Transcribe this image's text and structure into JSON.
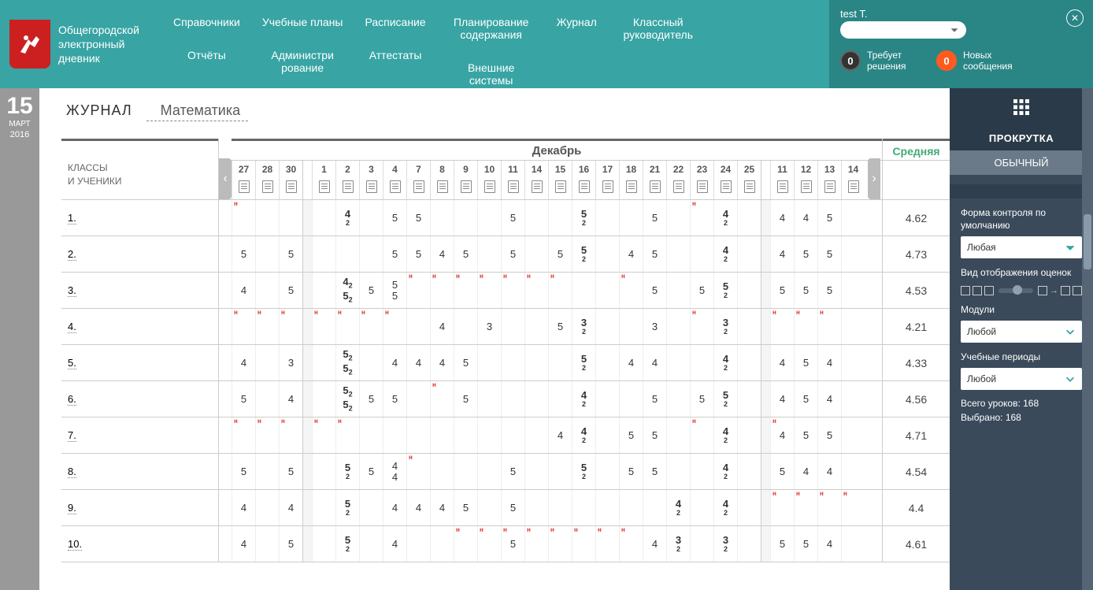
{
  "app_title": "Общегородской электронный дневник",
  "nav": {
    "col1": [
      "Справочники",
      "Отчёты"
    ],
    "col2": [
      "Учебные планы",
      "Администри рование"
    ],
    "col3": [
      "Расписание",
      "Аттестаты"
    ],
    "col4": [
      "Планирование содержания",
      "Внешние системы"
    ],
    "col5": [
      "Журнал"
    ],
    "col6": [
      "Классный руководитель"
    ]
  },
  "user": {
    "name": "test T.",
    "counter1_value": "0",
    "counter1_label": "Требует решения",
    "counter2_value": "0",
    "counter2_label": "Новых сообщения"
  },
  "date": {
    "day": "15",
    "month": "МАРТ",
    "year": "2016"
  },
  "page": {
    "title": "ЖУРНАЛ",
    "subject": "Математика"
  },
  "grid": {
    "left_header": "КЛАССЫ\nИ УЧЕНИКИ",
    "month_label": "Декабрь",
    "avg_label": "Средняя",
    "days": [
      "27",
      "28",
      "30",
      "1",
      "2",
      "3",
      "4",
      "7",
      "8",
      "9",
      "10",
      "11",
      "14",
      "15",
      "16",
      "17",
      "18",
      "21",
      "22",
      "23",
      "24",
      "25",
      "11",
      "12",
      "13",
      "14"
    ],
    "sep_after_indices": [
      2,
      21
    ],
    "students": [
      "1.",
      "2.",
      "3.",
      "4.",
      "5.",
      "6.",
      "7.",
      "8.",
      "9.",
      "10."
    ],
    "averages": [
      "4.62",
      "4.73",
      "4.53",
      "4.21",
      "4.33",
      "4.56",
      "4.71",
      "4.54",
      "4.4",
      "4.61"
    ],
    "grades": [
      {
        "r": 0,
        "c": 4,
        "v": "4",
        "s": "2",
        "b": true
      },
      {
        "r": 0,
        "c": 6,
        "v": "5"
      },
      {
        "r": 0,
        "c": 7,
        "v": "5"
      },
      {
        "r": 0,
        "c": 11,
        "v": "5"
      },
      {
        "r": 0,
        "c": 14,
        "v": "5",
        "s": "2",
        "b": true
      },
      {
        "r": 0,
        "c": 17,
        "v": "5"
      },
      {
        "r": 0,
        "c": 20,
        "v": "4",
        "s": "2",
        "b": true
      },
      {
        "r": 0,
        "c": 22,
        "v": "4"
      },
      {
        "r": 0,
        "c": 23,
        "v": "4"
      },
      {
        "r": 0,
        "c": 24,
        "v": "5"
      },
      {
        "r": 1,
        "c": 0,
        "v": "5"
      },
      {
        "r": 1,
        "c": 2,
        "v": "5"
      },
      {
        "r": 1,
        "c": 6,
        "v": "5"
      },
      {
        "r": 1,
        "c": 7,
        "v": "5"
      },
      {
        "r": 1,
        "c": 8,
        "v": "4"
      },
      {
        "r": 1,
        "c": 9,
        "v": "5"
      },
      {
        "r": 1,
        "c": 11,
        "v": "5"
      },
      {
        "r": 1,
        "c": 13,
        "v": "5"
      },
      {
        "r": 1,
        "c": 14,
        "v": "5",
        "s": "2",
        "b": true
      },
      {
        "r": 1,
        "c": 16,
        "v": "4"
      },
      {
        "r": 1,
        "c": 17,
        "v": "5"
      },
      {
        "r": 1,
        "c": 20,
        "v": "4",
        "s": "2",
        "b": true
      },
      {
        "r": 1,
        "c": 22,
        "v": "4"
      },
      {
        "r": 1,
        "c": 23,
        "v": "5"
      },
      {
        "r": 1,
        "c": 24,
        "v": "5"
      },
      {
        "r": 2,
        "c": 0,
        "v": "4"
      },
      {
        "r": 2,
        "c": 2,
        "v": "5"
      },
      {
        "r": 2,
        "c": 4,
        "v2": [
          "4₂",
          "5₂"
        ],
        "b": true
      },
      {
        "r": 2,
        "c": 5,
        "v": "5"
      },
      {
        "r": 2,
        "c": 6,
        "v2": [
          "5",
          "5"
        ]
      },
      {
        "r": 2,
        "c": 17,
        "v": "5"
      },
      {
        "r": 2,
        "c": 19,
        "v": "5"
      },
      {
        "r": 2,
        "c": 20,
        "v": "5",
        "s": "2",
        "b": true
      },
      {
        "r": 2,
        "c": 22,
        "v": "5"
      },
      {
        "r": 2,
        "c": 23,
        "v": "5"
      },
      {
        "r": 2,
        "c": 24,
        "v": "5"
      },
      {
        "r": 3,
        "c": 8,
        "v": "4"
      },
      {
        "r": 3,
        "c": 10,
        "v": "3"
      },
      {
        "r": 3,
        "c": 13,
        "v": "5"
      },
      {
        "r": 3,
        "c": 14,
        "v": "3",
        "s": "2",
        "b": true
      },
      {
        "r": 3,
        "c": 17,
        "v": "3"
      },
      {
        "r": 3,
        "c": 20,
        "v": "3",
        "s": "2",
        "b": true
      },
      {
        "r": 4,
        "c": 0,
        "v": "4"
      },
      {
        "r": 4,
        "c": 2,
        "v": "3"
      },
      {
        "r": 4,
        "c": 4,
        "v2": [
          "5₂",
          "5₂"
        ],
        "b": true
      },
      {
        "r": 4,
        "c": 6,
        "v": "4"
      },
      {
        "r": 4,
        "c": 7,
        "v": "4"
      },
      {
        "r": 4,
        "c": 8,
        "v": "4"
      },
      {
        "r": 4,
        "c": 9,
        "v": "5"
      },
      {
        "r": 4,
        "c": 14,
        "v": "5",
        "s": "2",
        "b": true
      },
      {
        "r": 4,
        "c": 16,
        "v": "4"
      },
      {
        "r": 4,
        "c": 17,
        "v": "4"
      },
      {
        "r": 4,
        "c": 20,
        "v": "4",
        "s": "2",
        "b": true
      },
      {
        "r": 4,
        "c": 22,
        "v": "4"
      },
      {
        "r": 4,
        "c": 23,
        "v": "5"
      },
      {
        "r": 4,
        "c": 24,
        "v": "4"
      },
      {
        "r": 5,
        "c": 0,
        "v": "5"
      },
      {
        "r": 5,
        "c": 2,
        "v": "4"
      },
      {
        "r": 5,
        "c": 4,
        "v2": [
          "5₂",
          "5₂"
        ],
        "b": true
      },
      {
        "r": 5,
        "c": 5,
        "v": "5"
      },
      {
        "r": 5,
        "c": 6,
        "v": "5"
      },
      {
        "r": 5,
        "c": 9,
        "v": "5"
      },
      {
        "r": 5,
        "c": 14,
        "v": "4",
        "s": "2",
        "b": true
      },
      {
        "r": 5,
        "c": 17,
        "v": "5"
      },
      {
        "r": 5,
        "c": 19,
        "v": "5"
      },
      {
        "r": 5,
        "c": 20,
        "v": "5",
        "s": "2",
        "b": true
      },
      {
        "r": 5,
        "c": 22,
        "v": "4"
      },
      {
        "r": 5,
        "c": 23,
        "v": "5"
      },
      {
        "r": 5,
        "c": 24,
        "v": "4"
      },
      {
        "r": 6,
        "c": 13,
        "v": "4"
      },
      {
        "r": 6,
        "c": 14,
        "v": "4",
        "s": "2",
        "b": true
      },
      {
        "r": 6,
        "c": 16,
        "v": "5"
      },
      {
        "r": 6,
        "c": 17,
        "v": "5"
      },
      {
        "r": 6,
        "c": 20,
        "v": "4",
        "s": "2",
        "b": true
      },
      {
        "r": 6,
        "c": 22,
        "v": "4"
      },
      {
        "r": 6,
        "c": 23,
        "v": "5"
      },
      {
        "r": 6,
        "c": 24,
        "v": "5"
      },
      {
        "r": 7,
        "c": 0,
        "v": "5"
      },
      {
        "r": 7,
        "c": 2,
        "v": "5"
      },
      {
        "r": 7,
        "c": 4,
        "v": "5",
        "s": "2",
        "b": true
      },
      {
        "r": 7,
        "c": 5,
        "v": "5"
      },
      {
        "r": 7,
        "c": 6,
        "v2": [
          "4",
          "4"
        ]
      },
      {
        "r": 7,
        "c": 11,
        "v": "5"
      },
      {
        "r": 7,
        "c": 14,
        "v": "5",
        "s": "2",
        "b": true
      },
      {
        "r": 7,
        "c": 16,
        "v": "5"
      },
      {
        "r": 7,
        "c": 17,
        "v": "5"
      },
      {
        "r": 7,
        "c": 20,
        "v": "4",
        "s": "2",
        "b": true
      },
      {
        "r": 7,
        "c": 22,
        "v": "5"
      },
      {
        "r": 7,
        "c": 23,
        "v": "4"
      },
      {
        "r": 7,
        "c": 24,
        "v": "4"
      },
      {
        "r": 8,
        "c": 0,
        "v": "4"
      },
      {
        "r": 8,
        "c": 2,
        "v": "4"
      },
      {
        "r": 8,
        "c": 4,
        "v": "5",
        "s": "2",
        "b": true
      },
      {
        "r": 8,
        "c": 6,
        "v": "4"
      },
      {
        "r": 8,
        "c": 7,
        "v": "4"
      },
      {
        "r": 8,
        "c": 8,
        "v": "4"
      },
      {
        "r": 8,
        "c": 9,
        "v": "5"
      },
      {
        "r": 8,
        "c": 11,
        "v": "5"
      },
      {
        "r": 8,
        "c": 18,
        "v": "4",
        "s": "2",
        "b": true
      },
      {
        "r": 8,
        "c": 20,
        "v": "4",
        "s": "2",
        "b": true
      },
      {
        "r": 9,
        "c": 0,
        "v": "4"
      },
      {
        "r": 9,
        "c": 2,
        "v": "5"
      },
      {
        "r": 9,
        "c": 4,
        "v": "5",
        "s": "2",
        "b": true
      },
      {
        "r": 9,
        "c": 6,
        "v": "4"
      },
      {
        "r": 9,
        "c": 11,
        "v": "5"
      },
      {
        "r": 9,
        "c": 17,
        "v": "4"
      },
      {
        "r": 9,
        "c": 18,
        "v": "3",
        "s": "2",
        "b": true
      },
      {
        "r": 9,
        "c": 20,
        "v": "3",
        "s": "2",
        "b": true
      },
      {
        "r": 9,
        "c": 22,
        "v": "5"
      },
      {
        "r": 9,
        "c": 23,
        "v": "5"
      },
      {
        "r": 9,
        "c": 24,
        "v": "4"
      }
    ],
    "n_marks": [
      {
        "r": 0,
        "c": [
          0,
          19
        ]
      },
      {
        "r": 2,
        "c": [
          7,
          8,
          9,
          10,
          11,
          12,
          13,
          16
        ]
      },
      {
        "r": 3,
        "c": [
          0,
          1,
          2,
          3,
          4,
          5,
          6,
          19,
          22,
          23,
          24
        ]
      },
      {
        "r": 5,
        "c": [
          8
        ]
      },
      {
        "r": 6,
        "c": [
          0,
          1,
          2,
          3,
          4,
          19,
          22
        ]
      },
      {
        "r": 7,
        "c": [
          7
        ]
      },
      {
        "r": 8,
        "c": [
          22,
          23,
          24,
          25
        ]
      },
      {
        "r": 9,
        "c": [
          9,
          10,
          11,
          12,
          13,
          14,
          15,
          16
        ]
      }
    ]
  },
  "sidebar": {
    "section_title": "ПРОКРУТКА",
    "tab_label": "ОБЫЧНЫЙ",
    "control_form_label": "Форма контроля по умолчанию",
    "control_form_value": "Любая",
    "display_label": "Вид отображения оценок",
    "modules_label": "Модули",
    "modules_value": "Любой",
    "periods_label": "Учебные периоды",
    "periods_value": "Любой",
    "total_lessons": "Всего уроков: 168",
    "selected": "Выбрано: 168"
  }
}
